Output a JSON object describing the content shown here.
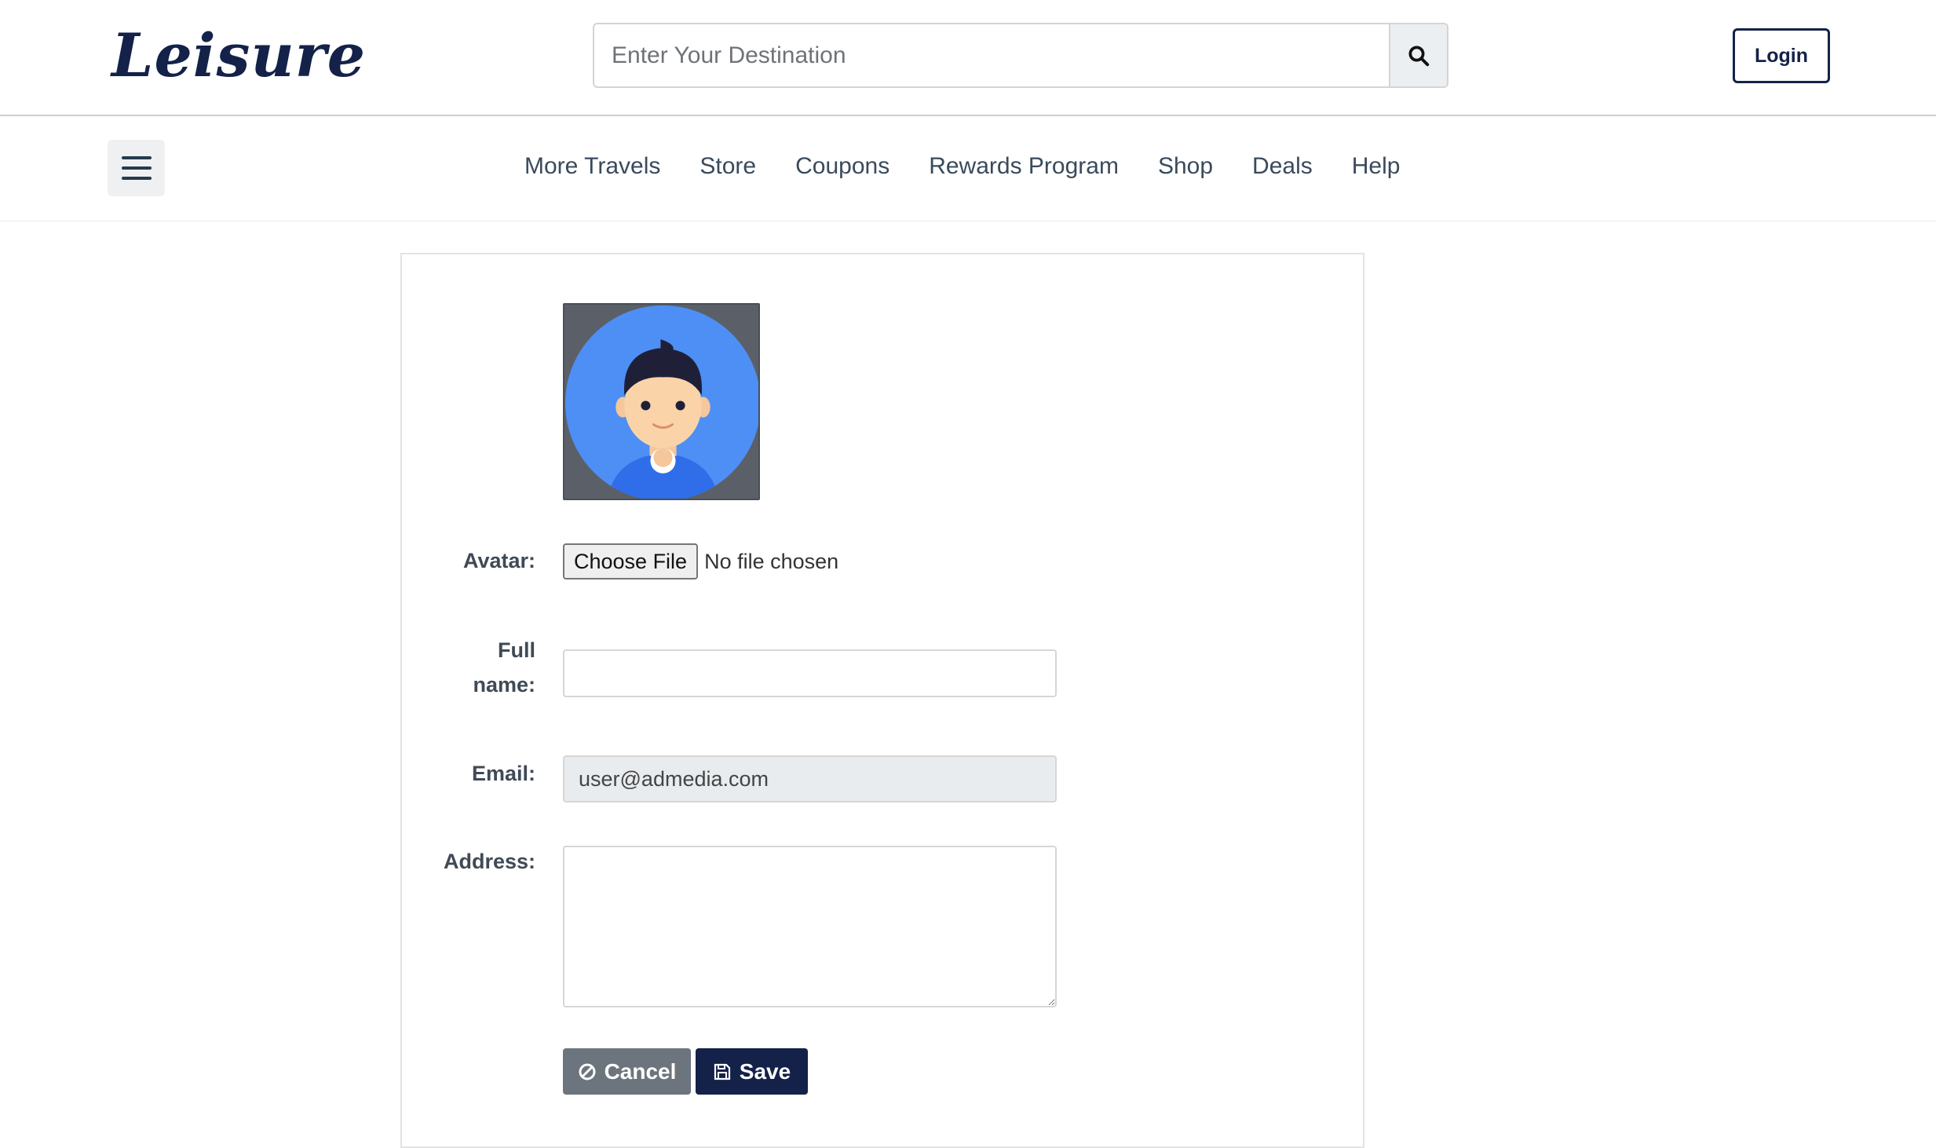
{
  "header": {
    "logo": "Leisure",
    "search_placeholder": "Enter Your Destination",
    "login_label": "Login"
  },
  "nav": {
    "links": [
      "More Travels",
      "Store",
      "Coupons",
      "Rewards Program",
      "Shop",
      "Deals",
      "Help"
    ]
  },
  "form": {
    "avatar_label": "Avatar:",
    "choose_file_label": "Choose File",
    "file_status": "No file chosen",
    "fullname_label_line1": "Full",
    "fullname_label_line2": "name:",
    "fullname_value": "",
    "email_label": "Email:",
    "email_value": "user@admedia.com",
    "address_label": "Address:",
    "address_value": "",
    "cancel_label": "Cancel",
    "save_label": "Save"
  },
  "colors": {
    "brand": "#14224a",
    "cancel": "#6c757d",
    "avatar_bg": "#4d8ff5"
  },
  "icons": {
    "search": "search-icon",
    "menu": "hamburger-menu-icon",
    "cancel": "ban-icon",
    "save": "floppy-disk-icon"
  }
}
